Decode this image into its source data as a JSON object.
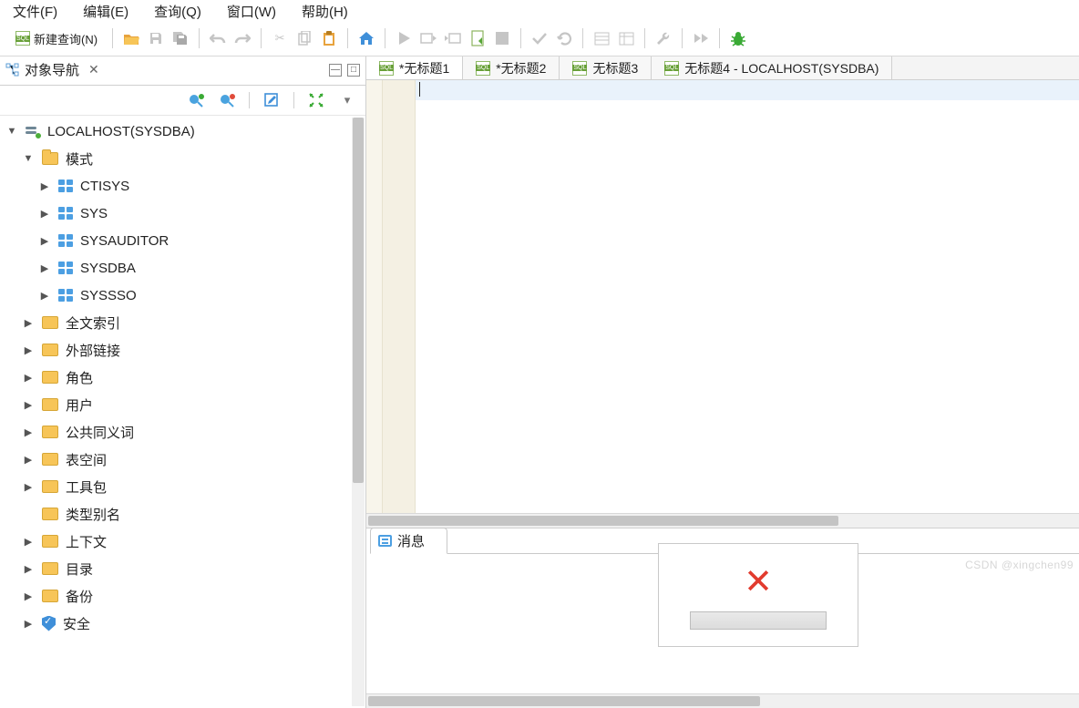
{
  "menu": {
    "items": [
      "文件(F)",
      "编辑(E)",
      "查询(Q)",
      "窗口(W)",
      "帮助(H)"
    ]
  },
  "toolbar": {
    "new_query": "新建查询(N)"
  },
  "object_nav": {
    "title": "对象导航",
    "root": "LOCALHOST(SYSDBA)",
    "schema_folder": "模式",
    "schemas": [
      "CTISYS",
      "SYS",
      "SYSAUDITOR",
      "SYSDBA",
      "SYSSSO"
    ],
    "folders": [
      "全文索引",
      "外部链接",
      "角色",
      "用户",
      "公共同义词",
      "表空间",
      "工具包",
      "类型别名",
      "上下文",
      "目录",
      "备份",
      "安全"
    ]
  },
  "editor_tabs": [
    {
      "label": "*无标题1"
    },
    {
      "label": "*无标题2"
    },
    {
      "label": "无标题3"
    },
    {
      "label": "无标题4 - LOCALHOST(SYSDBA)"
    }
  ],
  "bottom_panel": {
    "tab": "消息"
  },
  "watermark": "CSDN @xingchen99"
}
